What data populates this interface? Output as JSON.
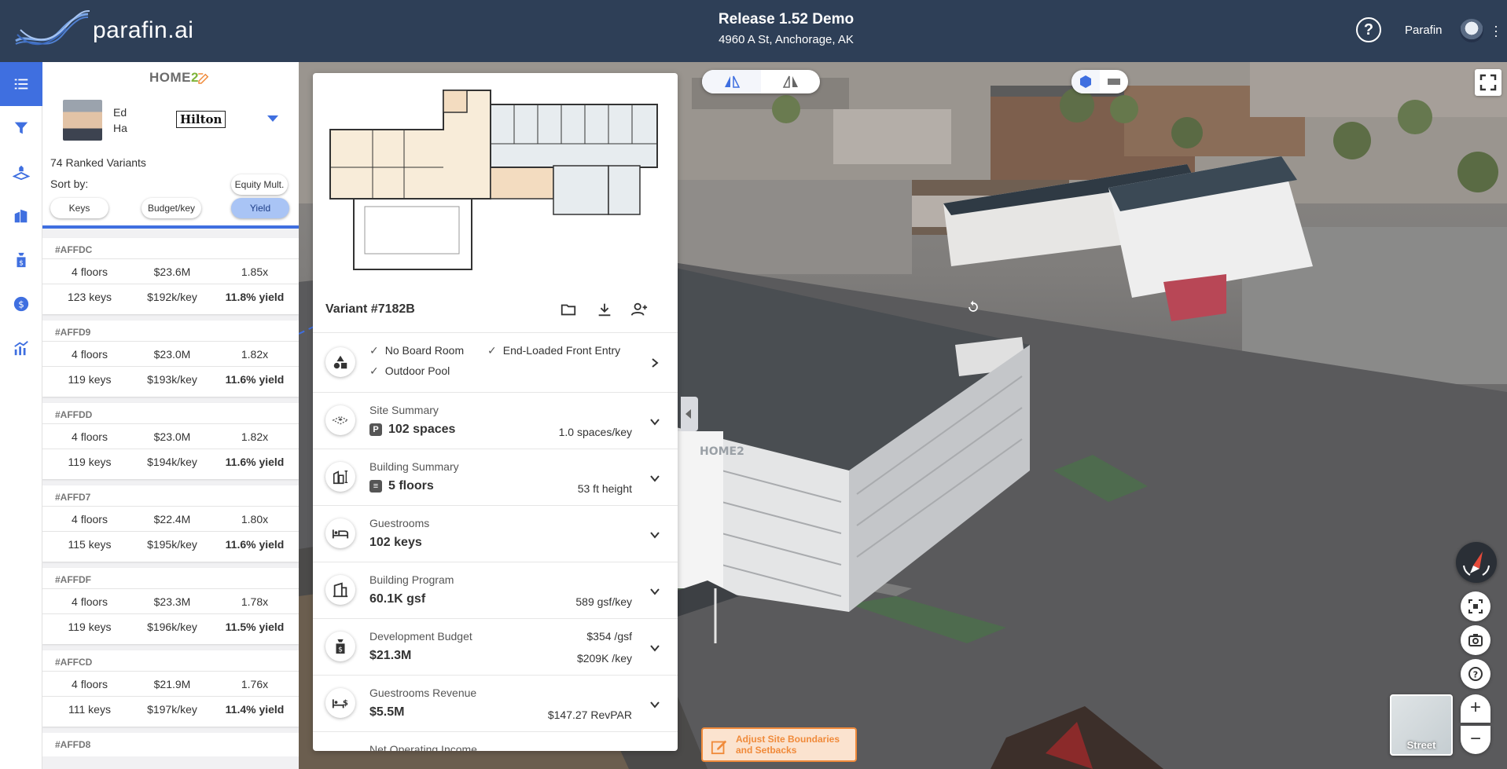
{
  "header": {
    "logo_text": "parafin.ai",
    "title": "Release 1.52 Demo",
    "address": "4960 A St, Anchorage, AK",
    "help_label": "?",
    "user_name": "Parafin"
  },
  "sidebar_icons": [
    {
      "name": "list-icon",
      "active": true
    },
    {
      "name": "filter-icon",
      "active": false
    },
    {
      "name": "site-icon",
      "active": false
    },
    {
      "name": "building-icon",
      "active": false
    },
    {
      "name": "budget-icon",
      "active": false
    },
    {
      "name": "dollar-icon",
      "active": false
    },
    {
      "name": "analytics-icon",
      "active": false
    }
  ],
  "brand_panel": {
    "brand_logo_main": "HOME",
    "brand_logo_num": "2",
    "person_first": "Ed",
    "person_last": "Ha",
    "franchise": "Hilton",
    "ranked_label": "74 Ranked Variants",
    "sort_by_label": "Sort by:",
    "sort_options": {
      "equity": "Equity Mult.",
      "keys": "Keys",
      "budget": "Budget/key",
      "yield": "Yield"
    },
    "selected_sort": "yield"
  },
  "variants": [
    {
      "id": "#AFFDC",
      "floors": "4 floors",
      "cost": "$23.6M",
      "equity": "1.85x",
      "keys": "123 keys",
      "per_key": "$192k/key",
      "yield": "11.8% yield"
    },
    {
      "id": "#AFFD9",
      "floors": "4 floors",
      "cost": "$23.0M",
      "equity": "1.82x",
      "keys": "119 keys",
      "per_key": "$193k/key",
      "yield": "11.6% yield"
    },
    {
      "id": "#AFFDD",
      "floors": "4 floors",
      "cost": "$23.0M",
      "equity": "1.82x",
      "keys": "119 keys",
      "per_key": "$194k/key",
      "yield": "11.6% yield"
    },
    {
      "id": "#AFFD7",
      "floors": "4 floors",
      "cost": "$22.4M",
      "equity": "1.80x",
      "keys": "115 keys",
      "per_key": "$195k/key",
      "yield": "11.6% yield"
    },
    {
      "id": "#AFFDF",
      "floors": "4 floors",
      "cost": "$23.3M",
      "equity": "1.78x",
      "keys": "119 keys",
      "per_key": "$196k/key",
      "yield": "11.5% yield"
    },
    {
      "id": "#AFFCD",
      "floors": "4 floors",
      "cost": "$21.9M",
      "equity": "1.76x",
      "keys": "111 keys",
      "per_key": "$197k/key",
      "yield": "11.4% yield"
    }
  ],
  "variant_last_id": "#AFFD8",
  "detail": {
    "title": "Variant #7182B",
    "features": [
      "No Board Room",
      "End-Loaded Front Entry",
      "Outdoor Pool"
    ],
    "site_summary": {
      "label": "Site Summary",
      "badge": "P",
      "value": "102 spaces",
      "aux": "1.0 spaces/key"
    },
    "building_summary": {
      "label": "Building Summary",
      "value": "5 floors",
      "aux": "53 ft height"
    },
    "guestrooms": {
      "label": "Guestrooms",
      "value": "102 keys"
    },
    "building_program": {
      "label": "Building Program",
      "value": "60.1K gsf",
      "aux": "589 gsf/key"
    },
    "development_budget": {
      "label": "Development Budget",
      "value": "$21.3M",
      "aux1": "$354 /gsf",
      "aux2": "$209K /key"
    },
    "guestrooms_revenue": {
      "label": "Guestrooms Revenue",
      "value": "$5.5M",
      "aux": "$147.27 RevPAR"
    },
    "noi": {
      "label": "Net Operating Income"
    }
  },
  "map": {
    "street_label": "Street",
    "adjust_label": "Adjust Site Boundaries and Setbacks",
    "zoom_in": "+",
    "zoom_out": "−",
    "building_sign": "HOME2",
    "colors": {
      "accent": "#3f6fe0",
      "header": "#2e3f57",
      "warning": "#f08a3a"
    }
  }
}
